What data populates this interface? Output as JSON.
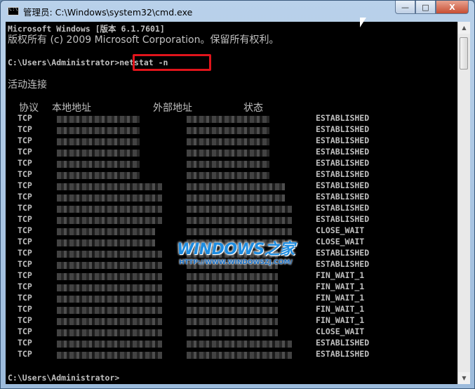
{
  "window": {
    "title": "管理员: C:\\Windows\\system32\\cmd.exe",
    "minimize": "—",
    "maximize": "□",
    "close": "X"
  },
  "console": {
    "line1": "Microsoft Windows [版本 6.1.7601]",
    "line2": "版权所有 (c) 2009 Microsoft Corporation。保留所有权利。",
    "prompt1": "C:\\Users\\Administrator>",
    "command": "netstat -n",
    "section": "活动连接",
    "headers": {
      "proto": "协议",
      "local": "本地地址",
      "foreign": "外部地址",
      "state": "状态"
    },
    "rows": [
      {
        "proto": "TCP",
        "state": "ESTABLISHED"
      },
      {
        "proto": "TCP",
        "state": "ESTABLISHED"
      },
      {
        "proto": "TCP",
        "state": "ESTABLISHED"
      },
      {
        "proto": "TCP",
        "state": "ESTABLISHED"
      },
      {
        "proto": "TCP",
        "state": "ESTABLISHED"
      },
      {
        "proto": "TCP",
        "state": "ESTABLISHED"
      },
      {
        "proto": "TCP",
        "state": "ESTABLISHED"
      },
      {
        "proto": "TCP",
        "state": "ESTABLISHED"
      },
      {
        "proto": "TCP",
        "state": "ESTABLISHED"
      },
      {
        "proto": "TCP",
        "state": "ESTABLISHED"
      },
      {
        "proto": "TCP",
        "state": "CLOSE_WAIT"
      },
      {
        "proto": "TCP",
        "state": "CLOSE_WAIT"
      },
      {
        "proto": "TCP",
        "state": "ESTABLISHED"
      },
      {
        "proto": "TCP",
        "state": "ESTABLISHED"
      },
      {
        "proto": "TCP",
        "state": "FIN_WAIT_1"
      },
      {
        "proto": "TCP",
        "state": "FIN_WAIT_1"
      },
      {
        "proto": "TCP",
        "state": "FIN_WAIT_1"
      },
      {
        "proto": "TCP",
        "state": "FIN_WAIT_1"
      },
      {
        "proto": "TCP",
        "state": "FIN_WAIT_1"
      },
      {
        "proto": "TCP",
        "state": "CLOSE_WAIT"
      },
      {
        "proto": "TCP",
        "state": "ESTABLISHED"
      },
      {
        "proto": "TCP",
        "state": "ESTABLISHED"
      }
    ],
    "prompt2": "C:\\Users\\Administrator>"
  },
  "watermark": {
    "logo": "WINDOWS之家",
    "url": "HTTP://WWW.WINDOWSZJ.COM/"
  },
  "icons": [
    "cmd-icon",
    "minimize-icon",
    "maximize-icon",
    "close-icon",
    "mouse-cursor-icon"
  ],
  "colors": {
    "console_bg": "#000000",
    "console_text": "#c0c0c0",
    "highlight": "#e0141b",
    "watermark": "#1e8ce0"
  }
}
